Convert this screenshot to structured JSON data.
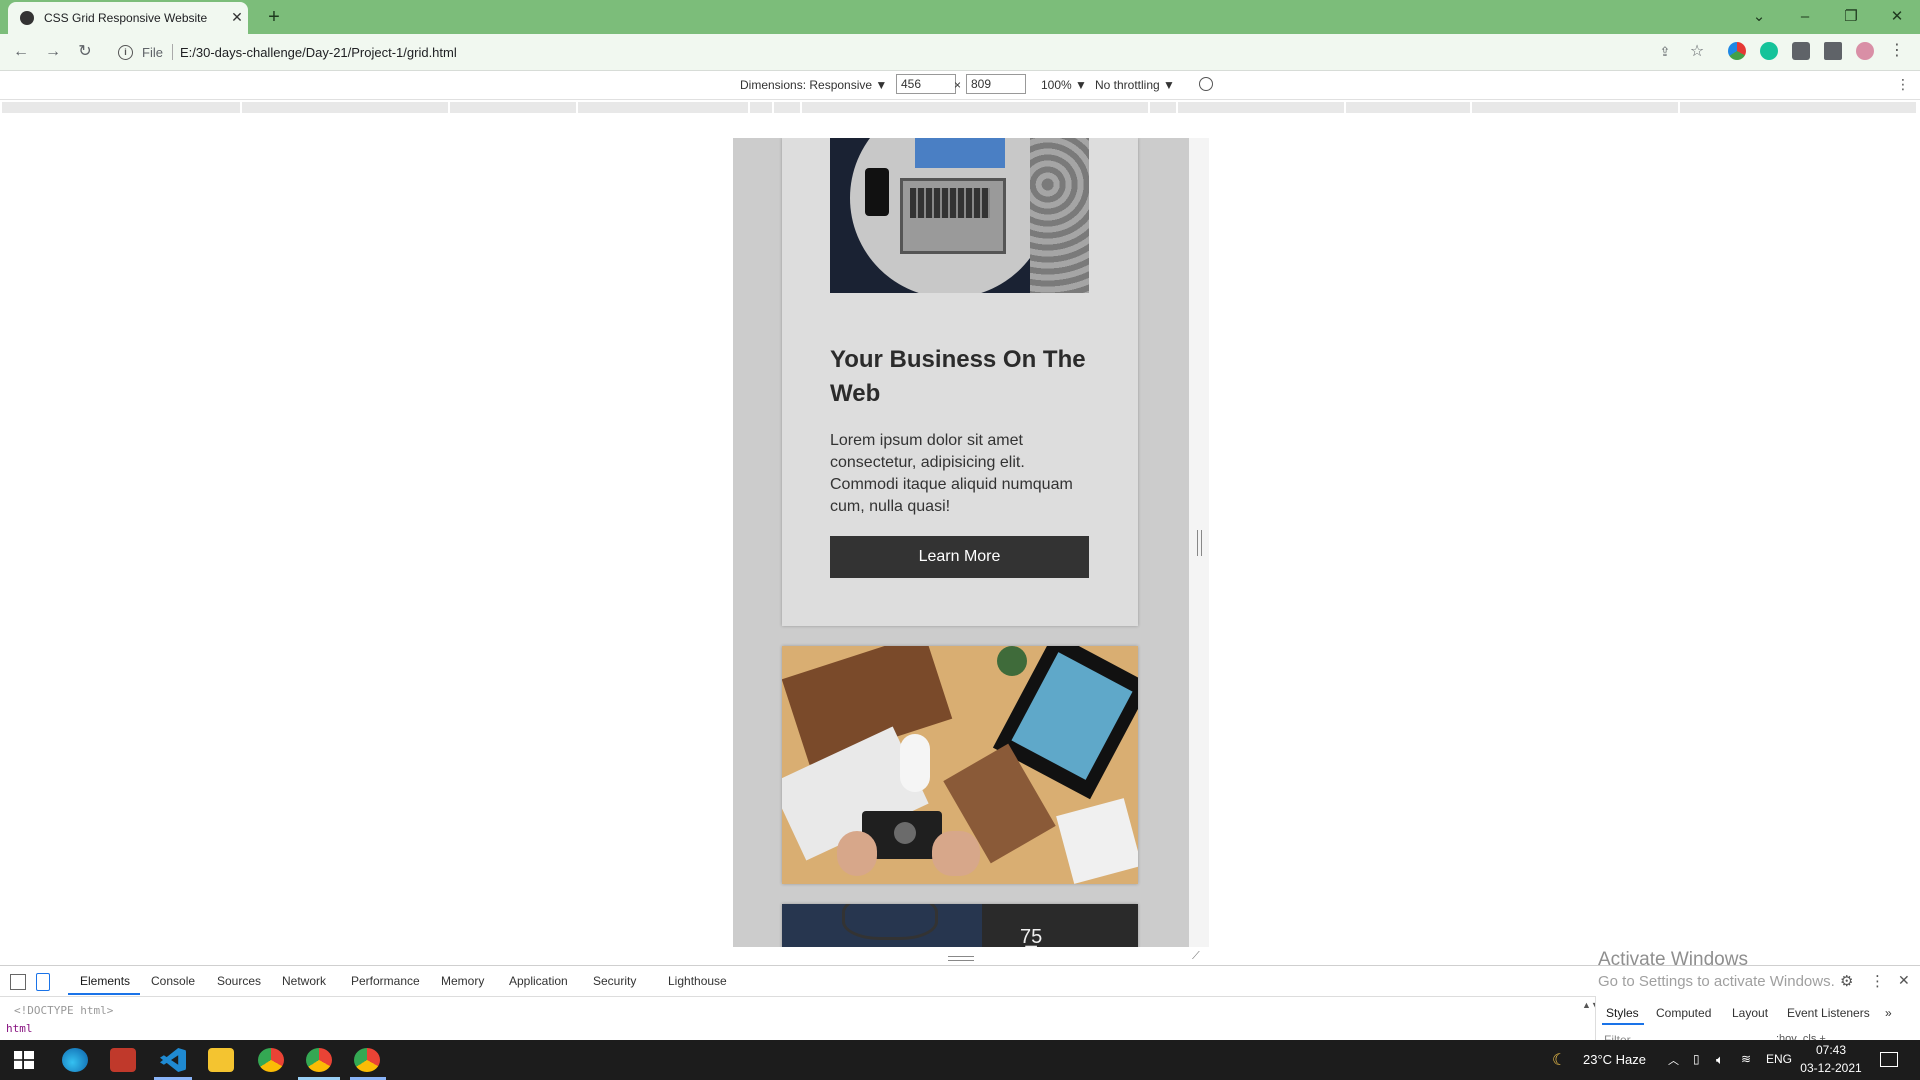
{
  "browser": {
    "tab_title": "CSS Grid Responsive Website",
    "tab_close": "✕",
    "new_tab": "+",
    "file_label": "File",
    "url": "E:/30-days-challenge/Day-21/Project-1/grid.html"
  },
  "device_toolbar": {
    "dimensions_label": "Dimensions: Responsive ▼",
    "width": "456",
    "x": "×",
    "height": "809",
    "zoom": "100% ▼",
    "throttling": "No throttling ▼"
  },
  "page": {
    "card_title": "Your Business On The Web",
    "card_text": "Lorem ipsum dolor sit amet consectetur, adipisicing elit. Commodi itaque aliquid numquam cum, nulla quasi!",
    "button_label": "Learn More"
  },
  "devtools": {
    "tabs": [
      "Elements",
      "Console",
      "Sources",
      "Network",
      "Performance",
      "Memory",
      "Application",
      "Security",
      "Lighthouse"
    ],
    "doctype": "<!DOCTYPE html>",
    "breadcrumb": "html",
    "styles_tabs": [
      "Styles",
      "Computed",
      "Layout",
      "Event Listeners",
      "»"
    ],
    "filter_placeholder": "Filter",
    "filter_options": ":hov  .cls  +"
  },
  "watermark": {
    "line1": "Activate Windows",
    "line2": "Go to Settings to activate Windows."
  },
  "taskbar": {
    "weather": "23°C  Haze",
    "language": "ENG",
    "time": "07:43",
    "date": "03-12-2021"
  },
  "colors": {
    "titlebar": "#7cbd7a",
    "viewport_bg": "#cccccc",
    "card_bg": "#dddddd",
    "button_bg": "#333333"
  },
  "icons": [
    "globe-icon",
    "back-icon",
    "forward-icon",
    "reload-icon",
    "info-icon",
    "share-icon",
    "star-icon",
    "extensions-icon",
    "profile-avatar",
    "rotate-icon",
    "inspect-icon",
    "device-toggle-icon",
    "settings-icon",
    "windows-start-icon",
    "edge-icon",
    "vscode-icon",
    "file-explorer-icon",
    "chrome-icon"
  ]
}
